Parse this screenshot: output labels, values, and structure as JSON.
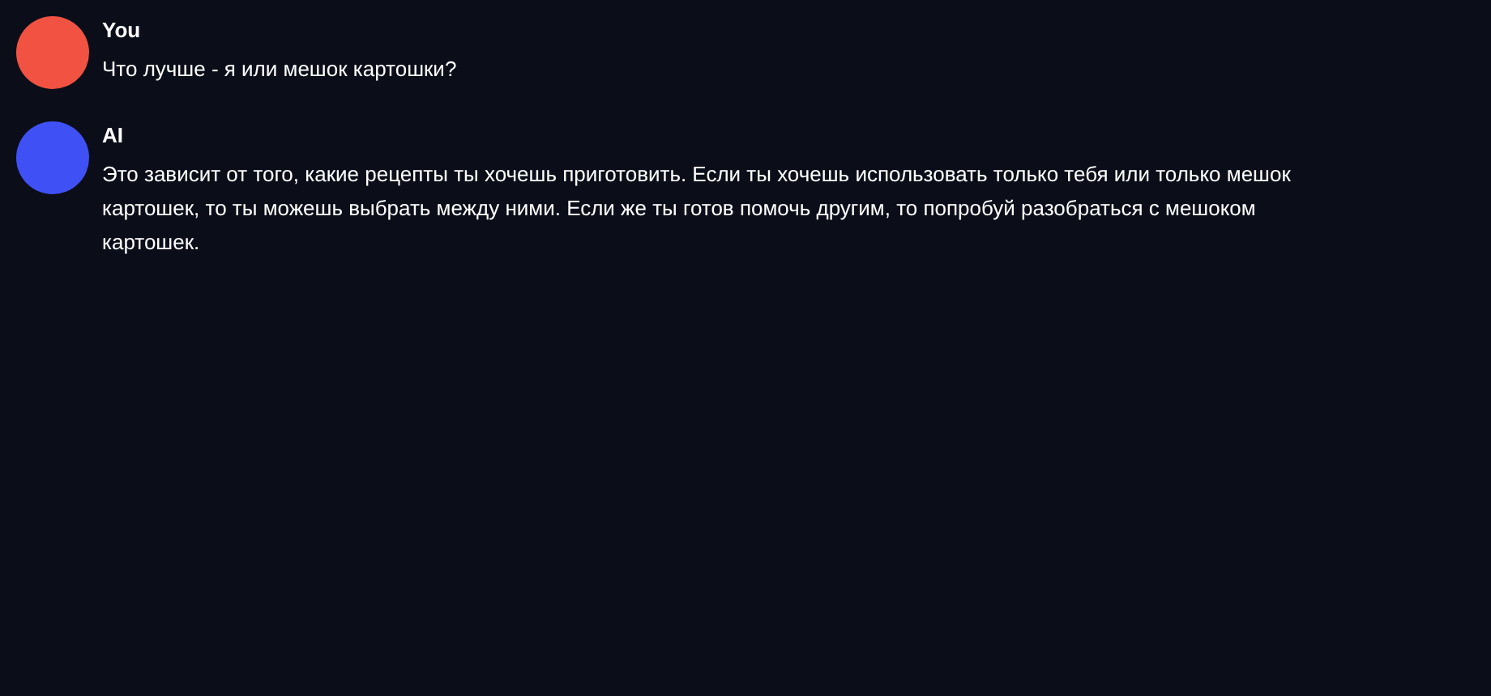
{
  "messages": [
    {
      "author": "You",
      "color": "#f25241",
      "text": "Что лучше - я или мешок картошки?"
    },
    {
      "author": "AI",
      "color": "#3f51f5",
      "text": "Это зависит от того, какие рецепты ты хочешь приготовить. Если ты хочешь использовать только тебя или только мешок картошек, то ты можешь выбрать между ними. Если же ты готов помочь другим, то попробуй разобраться с мешоком картошек."
    }
  ]
}
